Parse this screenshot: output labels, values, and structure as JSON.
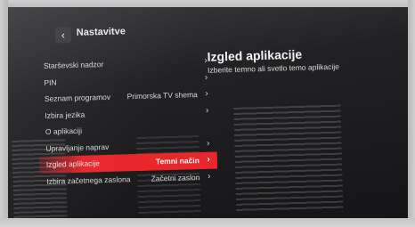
{
  "header": {
    "back_glyph": "‹",
    "title": "Nastavitve"
  },
  "menu": {
    "items": [
      {
        "label": "Starševski nadzor",
        "value": "",
        "chevron": "›"
      },
      {
        "label": "PIN",
        "value": "",
        "chevron": "›"
      },
      {
        "label": "Seznam programov",
        "value": "Primorska TV shema",
        "chevron": "›"
      },
      {
        "label": "Izbira jezika",
        "value": "",
        "chevron": "›"
      },
      {
        "label": "O aplikaciji",
        "value": "",
        "chevron": ""
      },
      {
        "label": "Upravljanje naprav",
        "value": "",
        "chevron": "›"
      },
      {
        "label": "Izgled aplikacije",
        "value": "Temni način",
        "chevron": "›"
      },
      {
        "label": "Izbira začetnega zaslona",
        "value": "Začetni zaslon",
        "chevron": "›"
      }
    ]
  },
  "detail": {
    "title": "Izgled aplikacije",
    "subtitle": "Izberite temno ali svetlo temo aplikacije"
  },
  "colors": {
    "accent": "#e8262b",
    "background": "#1c1c1e"
  }
}
